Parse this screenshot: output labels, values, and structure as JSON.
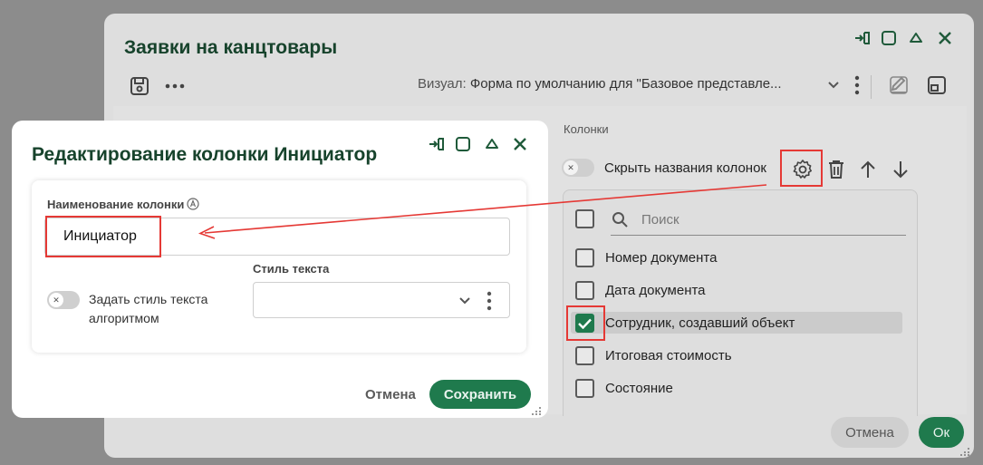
{
  "main_window": {
    "title": "Заявки на канцтовары",
    "visual_prefix": "Визуал:",
    "visual_value": "Форма по умолчанию для \"Базовое представле...",
    "columns_heading": "Колонки",
    "hide_column_names_label": "Скрыть названия колонок",
    "search_placeholder": "Поиск",
    "columns": [
      {
        "label": "Номер документа",
        "checked": false
      },
      {
        "label": "Дата документа",
        "checked": false
      },
      {
        "label": "Сотрудник, создавший объект",
        "checked": true
      },
      {
        "label": "Итоговая стоимость",
        "checked": false
      },
      {
        "label": "Состояние",
        "checked": false
      }
    ],
    "cancel_label": "Отмена",
    "ok_label": "Ок"
  },
  "dialog": {
    "title": "Редактирование колонки Инициатор",
    "column_name_label": "Наименование колонки",
    "column_name_value": "Инициатор",
    "algo_style_label": "Задать стиль текста алгоритмом",
    "text_style_label": "Стиль текста",
    "text_style_value": "",
    "cancel_label": "Отмена",
    "save_label": "Сохранить"
  },
  "colors": {
    "accent": "#1f7a4d",
    "title": "#17432c",
    "highlight": "#e53935"
  }
}
